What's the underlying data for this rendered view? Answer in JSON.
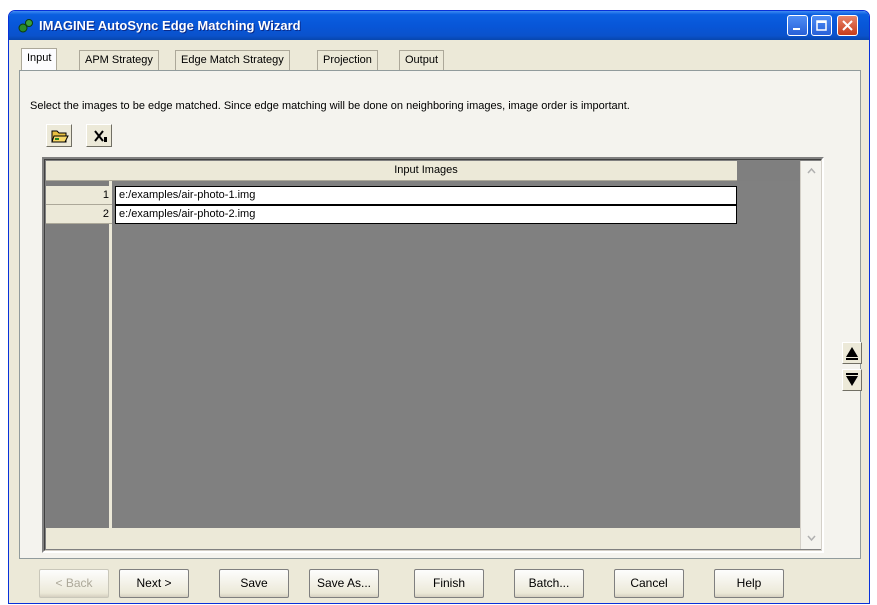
{
  "window": {
    "title": "IMAGINE AutoSync Edge Matching Wizard"
  },
  "tabs": [
    {
      "label": "Input",
      "active": true
    },
    {
      "label": "APM Strategy",
      "active": false
    },
    {
      "label": "Edge Match Strategy",
      "active": false
    },
    {
      "label": "Projection",
      "active": false
    },
    {
      "label": "Output",
      "active": false
    }
  ],
  "input_panel": {
    "instructions": "Select the images to be edge matched.  Since edge matching will be done on neighboring images, image order is important.",
    "toolbar": {
      "open_icon": "folder-open-icon",
      "delete_icon": "delete-icon"
    },
    "grid": {
      "column_header": "Input Images",
      "rows": [
        {
          "num": "1",
          "path": "e:/examples/air-photo-1.img"
        },
        {
          "num": "2",
          "path": "e:/examples/air-photo-2.img"
        }
      ]
    }
  },
  "footer_buttons": {
    "back": "< Back",
    "next": "Next >",
    "save": "Save",
    "save_as": "Save As...",
    "finish": "Finish",
    "batch": "Batch...",
    "cancel": "Cancel",
    "help": "Help"
  },
  "colors": {
    "titlebar": "#0856d8",
    "grid_background": "#808080",
    "dialog_background": "#ece9d8"
  }
}
